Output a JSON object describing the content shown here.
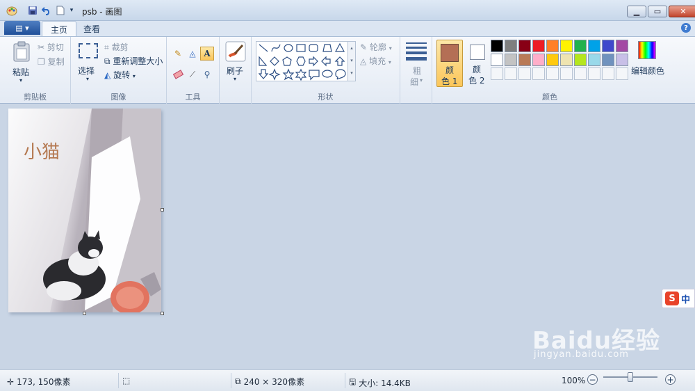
{
  "window": {
    "title": "psb - 画图",
    "minimize_icon": "minimize-icon",
    "maximize_icon": "maximize-icon",
    "close_icon": "close-icon"
  },
  "ribbon_tabs": {
    "file_menu_icon": "file-menu-icon",
    "tabs": [
      {
        "label": "主页",
        "active": true
      },
      {
        "label": "查看",
        "active": false
      }
    ],
    "help_label": "?"
  },
  "clipboard": {
    "group_label": "剪贴板",
    "paste": "粘贴",
    "cut": "剪切",
    "copy": "复制"
  },
  "image": {
    "group_label": "图像",
    "select": "选择",
    "crop": "裁剪",
    "resize": "重新调整大小",
    "rotate": "旋转"
  },
  "tools": {
    "group_label": "工具",
    "text_tool_glyph": "A",
    "selected_tool": "text"
  },
  "brushes": {
    "label": "刷子"
  },
  "shapes": {
    "group_label": "形状",
    "outline": "轮廓",
    "fill": "填充"
  },
  "size": {
    "label_line1": "粗",
    "label_line2": "细"
  },
  "colors": {
    "group_label": "颜色",
    "color1_line1": "颜",
    "color1_line2": "色 1",
    "color2_line1": "颜",
    "color2_line2": "色 2",
    "color1_value": "#b46f55",
    "color2_value": "#ffffff",
    "edit_colors": "编辑颜色",
    "palette_row1": [
      "#000000",
      "#7f7f7f",
      "#880015",
      "#ed1c24",
      "#ff7f27",
      "#fff200",
      "#22b14c",
      "#00a2e8",
      "#3f48cc",
      "#a349a4"
    ],
    "palette_row2": [
      "#ffffff",
      "#c3c3c3",
      "#b97a57",
      "#ffaec9",
      "#ffc90e",
      "#efe4b0",
      "#b5e61d",
      "#99d9ea",
      "#7092be",
      "#c8bfe7"
    ]
  },
  "canvas": {
    "caption": "小猫",
    "accent": "#b47850"
  },
  "ime": {
    "logo": "S",
    "mode": "中"
  },
  "watermark": {
    "brand": "Baidu经验",
    "url": "jingyan.baidu.com"
  },
  "status": {
    "cursor_pos": "173, 150像素",
    "image_size": "240 × 320像素",
    "file_size": "大小: 14.4KB",
    "zoom": "100%",
    "zoom_out": "−",
    "zoom_in": "+"
  }
}
